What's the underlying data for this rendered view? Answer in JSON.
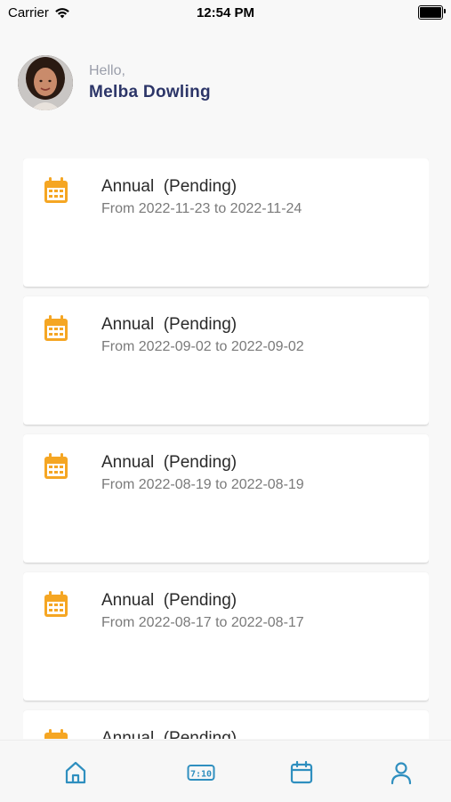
{
  "status_bar": {
    "carrier": "Carrier",
    "time": "12:54 PM"
  },
  "header": {
    "greeting": "Hello,",
    "user_name": "Melba  Dowling"
  },
  "leaves": [
    {
      "title": "Annual  (Pending)",
      "dates": "From 2022-11-23 to 2022-11-24"
    },
    {
      "title": "Annual  (Pending)",
      "dates": "From 2022-09-02 to 2022-09-02"
    },
    {
      "title": "Annual  (Pending)",
      "dates": "From 2022-08-19 to 2022-08-19"
    },
    {
      "title": "Annual  (Pending)",
      "dates": "From 2022-08-17 to 2022-08-17"
    },
    {
      "title": "Annual  (Pending)",
      "dates": ""
    }
  ],
  "tabbar": {
    "items": [
      {
        "icon": "home-icon"
      },
      {
        "icon": "clock-display-icon",
        "label": "7:10"
      },
      {
        "icon": "calendar-icon"
      },
      {
        "icon": "profile-icon"
      }
    ]
  },
  "colors": {
    "accent_orange": "#f5a623",
    "tab_blue": "#2f8fbf",
    "name_navy": "#2c3568"
  }
}
